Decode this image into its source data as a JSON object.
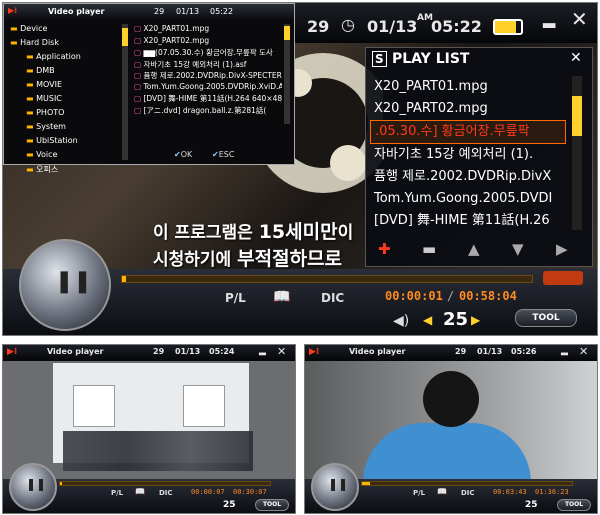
{
  "app": {
    "title": "Video player",
    "date": "01/13",
    "ampm": "AM"
  },
  "panels": {
    "main": {
      "channel": "29",
      "time": "05:22",
      "time_large": "05:22",
      "subtitle": {
        "line1_a": "이 프로그램은 ",
        "line1_b": "15세미만",
        "line1_c": "이",
        "line2_a": "시청하기에 ",
        "line2_b": "부적절하므로"
      },
      "elapsed": "00:00:01",
      "total": "00:58:04",
      "progress": 0.01,
      "volume": "25",
      "buttons": {
        "pl": "P/L",
        "dic": "DIC",
        "tool": "TOOL"
      },
      "playlist": {
        "header": "PLAY LIST",
        "items": [
          "X20_PART01.mpg",
          "X20_PART02.mpg",
          ".05.30.수] 황금어장.무릎팍",
          "자바기초 15강 예외처리 (1).",
          "퓸행 제로.2002.DVDRip.DivX",
          "Tom.Yum.Goong.2005.DVDI",
          "[DVD] 舞-HIME 第11話(H.26"
        ],
        "selected_index": 2
      },
      "filebrowser": {
        "tree": [
          "Device",
          "Hard Disk",
          "Application",
          "DMB",
          "MOVIE",
          "MUSIC",
          "PHOTO",
          "System",
          "UbiStation",
          "Voice",
          "오피스"
        ],
        "files": [
          "X20_PART01.mpg",
          "X20_PART02.mpg",
          "▆▆(07.05.30.수) 황금어장.무릎팍 도사",
          "자바기초 15강 예외처리 (1).asf",
          "퓸행 제로.2002.DVDRip.DivX-SPECTER",
          "Tom.Yum.Goong.2005.DVDRip.XviD.A",
          "[DVD] 舞-HIME 第11話(H.264 640×48",
          "[アニ.dvd] dragon.ball.z.第281話("
        ],
        "ok": "OK",
        "esc": "ESC"
      }
    },
    "left": {
      "channel": "29",
      "time": "05:24",
      "elapsed": "00:00:07",
      "total": "00:30:07",
      "progress": 0.004,
      "volume": "25",
      "buttons": {
        "pl": "P/L",
        "dic": "DIC",
        "tool": "TOOL"
      }
    },
    "right": {
      "channel": "29",
      "time": "05:26",
      "elapsed": "00:03:43",
      "total": "01:36:23",
      "progress": 0.04,
      "volume": "25",
      "buttons": {
        "pl": "P/L",
        "dic": "DIC",
        "tool": "TOOL"
      }
    }
  },
  "colors": {
    "accent": "#ffb400",
    "time": "#ff8a1f",
    "selected": "#ff3b1b"
  }
}
